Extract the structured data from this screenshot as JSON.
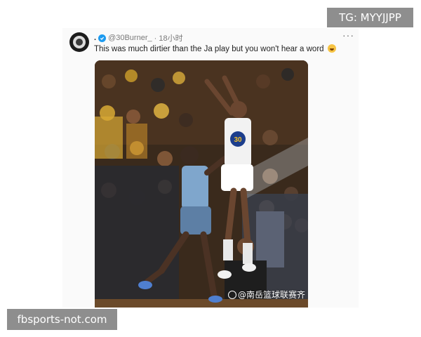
{
  "overlay": {
    "tg_label": "TG: MYYJJPP",
    "site_label": "fbsports-not.com"
  },
  "tweet": {
    "name_dot": ".",
    "handle": "@30Burner_",
    "time": "· 18小时",
    "more_icon": "more-dots-icon",
    "verified_color": "#1d9bf0",
    "text": "This was much dirtier than the Ja play but you won't hear a word",
    "emoji": "laughing-crying-emoji",
    "image": {
      "description_icon": "basketball-photo",
      "jersey_number": "30",
      "watermark": "@南岳篮球联赛齐"
    }
  }
}
